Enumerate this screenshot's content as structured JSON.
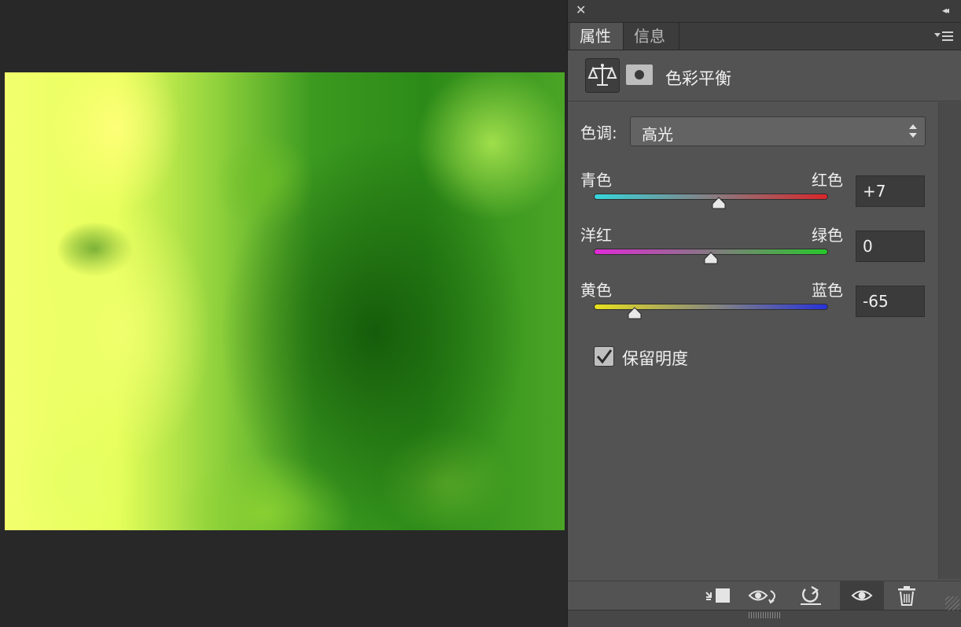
{
  "panel": {
    "tabs": [
      {
        "label": "属性",
        "active": true
      },
      {
        "label": "信息",
        "active": false
      }
    ],
    "title": "色彩平衡",
    "tone": {
      "label": "色调:",
      "value": "高光"
    },
    "sliders": [
      {
        "left": "青色",
        "right": "红色",
        "value": "+7",
        "position": 0.535,
        "gradient": [
          "#35d6dc",
          "#d8262a"
        ]
      },
      {
        "left": "洋红",
        "right": "绿色",
        "value": "0",
        "position": 0.5,
        "gradient": [
          "#e12ad8",
          "#27c82a"
        ]
      },
      {
        "left": "黄色",
        "right": "蓝色",
        "value": "-65",
        "position": 0.175,
        "gradient": [
          "#e8e01f",
          "#2832d8"
        ]
      }
    ],
    "preserve_luminosity": {
      "label": "保留明度",
      "checked": true
    }
  },
  "icons": {
    "close": "close-icon",
    "collapse": "double-chevron-right-icon",
    "panel_menu": "panel-menu-icon",
    "adjustment": "balance-scale-icon",
    "mask": "layer-mask-icon",
    "clip": "clip-to-layer-icon",
    "view_previous": "view-previous-state-icon",
    "reset": "reset-icon",
    "visibility": "eye-icon",
    "delete": "trash-icon"
  }
}
